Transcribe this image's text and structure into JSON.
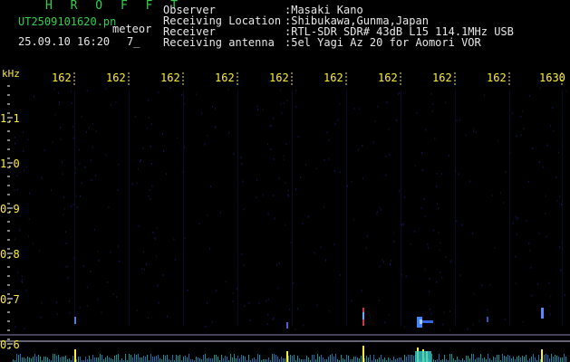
{
  "header": {
    "program": "H R O F F T",
    "filename": "UT2509101620.pn",
    "mode": "meteor",
    "datetime": "25.09.10 16:20",
    "count": "7_"
  },
  "info": [
    {
      "label": "Observer",
      "value": ":Masaki Kano"
    },
    {
      "label": "Receiving Location",
      "value": ":Shibukawa,Gunma,Japan"
    },
    {
      "label": "Receiver",
      "value": ":RTL-SDR SDR# 43dB L15 114.1MHz USB"
    },
    {
      "label": "Receiving antenna",
      "value": ":5el Yagi Az 20 for Aomori VOR"
    }
  ],
  "axis": {
    "unit": "kHz",
    "x_ticks": [
      "162",
      "162",
      "162",
      "162",
      "162",
      "162",
      "162",
      "162",
      "162",
      "1630"
    ],
    "y_ticks": [
      "1.1",
      "1.0",
      "0.9",
      "0.8",
      "0.7",
      "0.6"
    ]
  },
  "colors": {
    "header_green": "#2fd14a",
    "axis_yellow": "#ffee33",
    "text_white": "#e8e8e8",
    "background": "#000000"
  }
}
